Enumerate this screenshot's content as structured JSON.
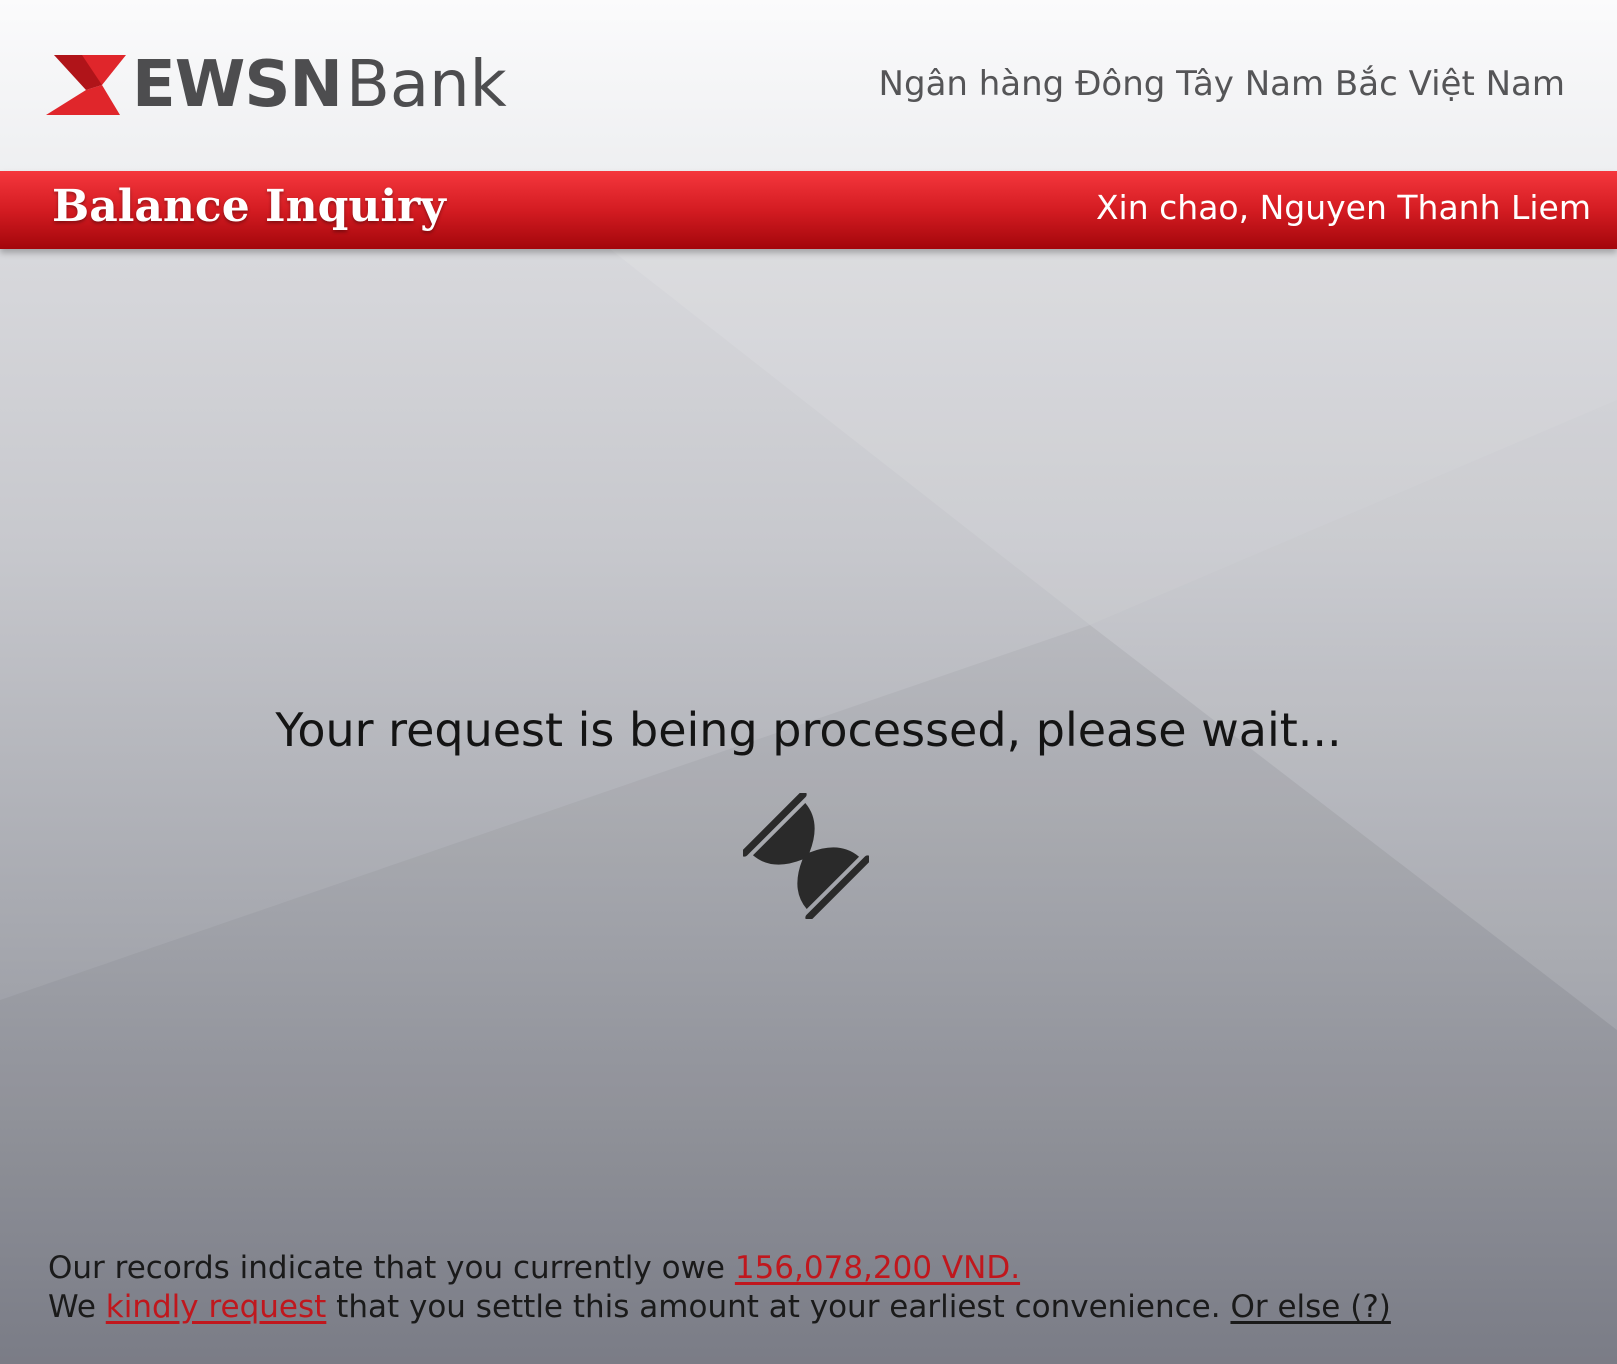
{
  "header": {
    "logo_bold": "EWSN",
    "logo_light": "Bank",
    "bank_fullname": "Ngân hàng Đông Tây Nam Bắc Việt Nam"
  },
  "title_bar": {
    "title": "Balance Inquiry",
    "greeting": "Xin chao, Nguyen Thanh Liem"
  },
  "main": {
    "processing_message": "Your request is being processed, please wait...",
    "icon": "hourglass-icon"
  },
  "footer": {
    "line1_prefix": "Our records indicate that you currently owe ",
    "amount": "156,078,200 VND.",
    "line2_prefix": "We ",
    "kindly_request": "kindly request",
    "line2_middle": " that you settle this amount at your earliest convenience. ",
    "or_else": "Or else (?)"
  },
  "colors": {
    "brand_red": "#d41c22",
    "link_red": "#c0171d",
    "logo_gray": "#4d4d4f"
  }
}
